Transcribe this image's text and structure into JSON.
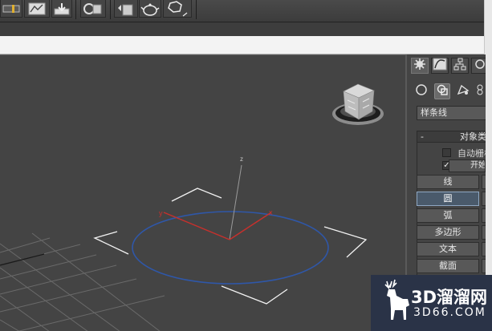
{
  "toolbar": {
    "buttons": [
      {
        "name": "select-filter-icon"
      },
      {
        "name": "curve-editor-icon"
      },
      {
        "name": "save-icon"
      },
      {
        "name": "render-setup-icon"
      },
      {
        "name": "material-editor-icon"
      },
      {
        "name": "teapot-render-icon"
      },
      {
        "name": "render-frame-icon"
      }
    ]
  },
  "viewport": {
    "axis_z": "z",
    "axis_y": "y",
    "axis_x": "x"
  },
  "command_panel": {
    "tabs": [
      {
        "name": "create-tab-icon",
        "active": true
      },
      {
        "name": "modify-tab-icon",
        "active": false
      },
      {
        "name": "hierarchy-tab-icon",
        "active": false
      }
    ],
    "subcategories": [
      {
        "name": "geometry-icon",
        "active": false
      },
      {
        "name": "shapes-icon",
        "active": true
      },
      {
        "name": "lights-icon",
        "active": false
      },
      {
        "name": "cameras-icon",
        "active": false
      }
    ],
    "category": "样条线",
    "rollout": {
      "collapse_symbol": "-",
      "title": "对象类型",
      "auto_grid_label": "自动栅格",
      "auto_grid_checked": false,
      "start_new_shape_checked": true,
      "start_new_shape_label": "开始新图形"
    },
    "shape_buttons": [
      {
        "label": "线",
        "selected": false
      },
      {
        "label": "圆",
        "selected": true
      },
      {
        "label": "弧",
        "selected": false
      },
      {
        "label": "多边形",
        "selected": false
      },
      {
        "label": "文本",
        "selected": false
      },
      {
        "label": "截面",
        "selected": false
      }
    ]
  },
  "watermark": {
    "brand": "3D溜溜网",
    "url": "3D66.COM"
  },
  "colors": {
    "viewport_bg": "#444444",
    "grid": "#6a6a6a",
    "circle": "#2f57a8",
    "axis_red": "#c8302c",
    "selection_bracket": "#f2f2f2"
  }
}
